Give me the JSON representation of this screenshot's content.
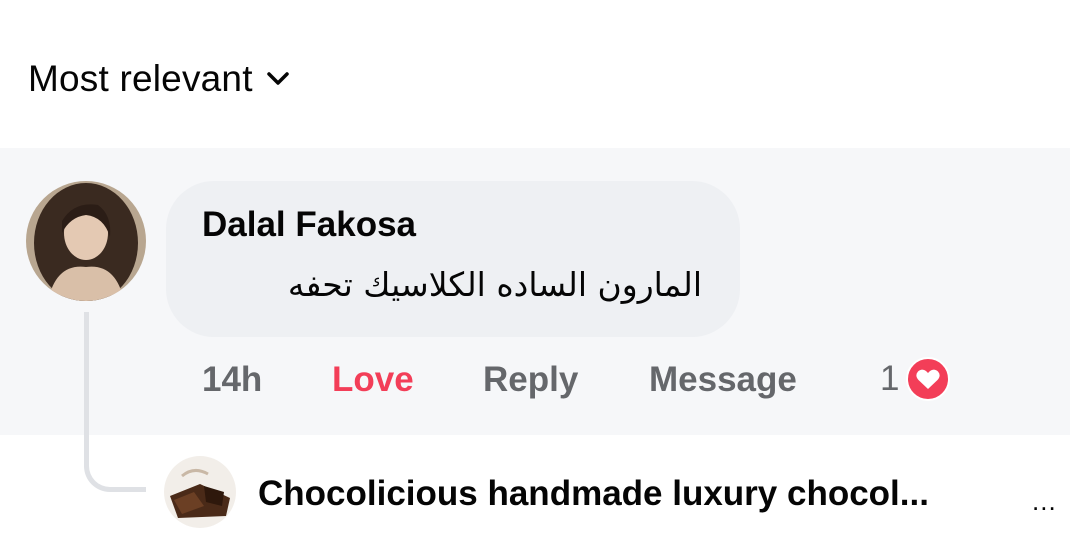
{
  "sort": {
    "label": "Most relevant",
    "icon": "chevron-down-icon"
  },
  "comment": {
    "author": "Dalal Fakosa",
    "text": "المارون الساده الكلاسيك تحفه",
    "time": "14h",
    "reaction_label": "Love",
    "reply_label": "Reply",
    "message_label": "Message",
    "reaction_count": "1",
    "reaction_icon": "heart-icon",
    "reaction_color": "#f33e58"
  },
  "reply": {
    "author": "Chocolicious  handmade luxury chocol...",
    "more": "..."
  },
  "colors": {
    "text": "#050505",
    "muted": "#65676b",
    "bubble": "#eef0f3",
    "band": "#f6f7f9"
  }
}
